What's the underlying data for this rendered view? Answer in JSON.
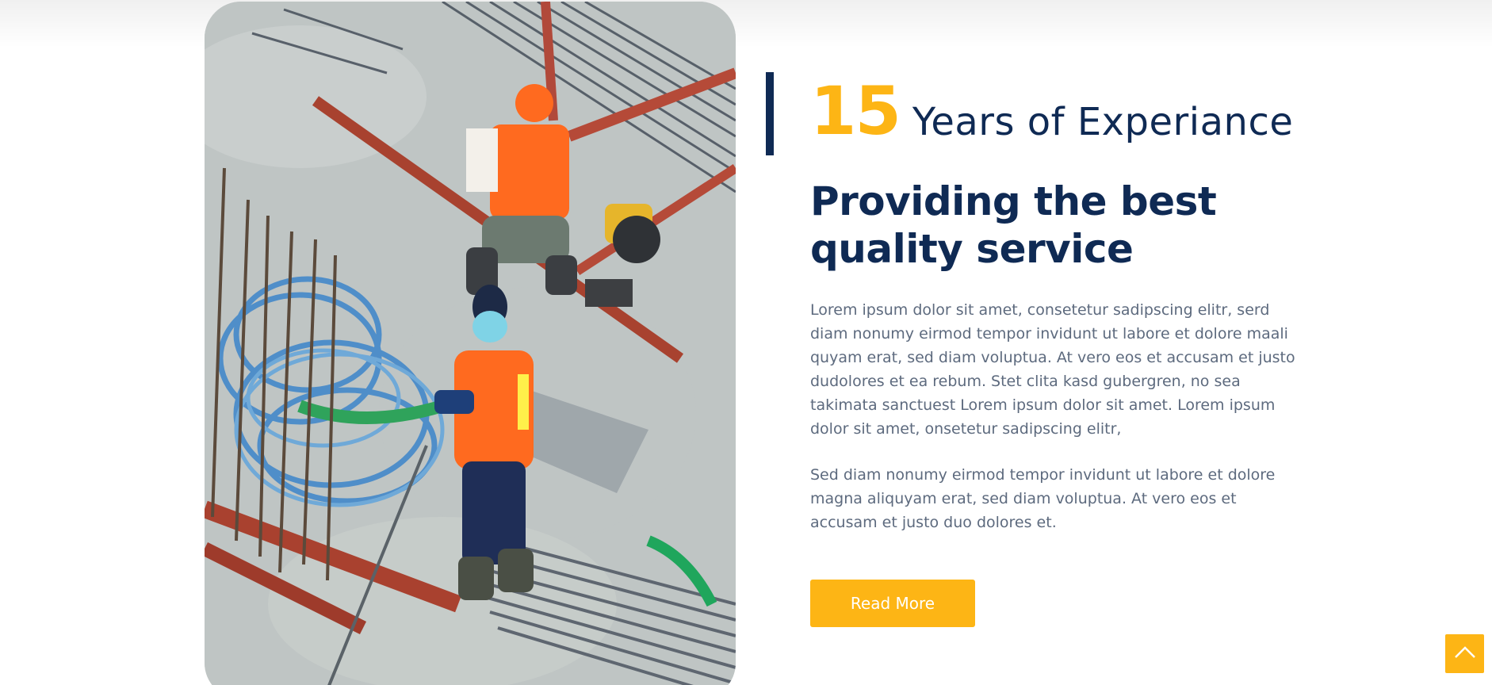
{
  "experience": {
    "number": "15",
    "label": "Years of Experiance"
  },
  "about": {
    "heading": "Providing the best quality service",
    "paragraph_1": "Lorem ipsum dolor sit amet, consetetur sadipscing elitr, serd diam nonumy eirmod tempor invidunt ut labore et dolore maali quyam erat, sed diam voluptua. At vero eos et accusam et justo dudolores et ea rebum. Stet clita kasd gubergren, no sea takimata sanctuest Lorem ipsum dolor sit amet. Lorem ipsum dolor sit amet, onsetetur sadipscing elitr,",
    "paragraph_2": "Sed diam nonumy eirmod tempor invidunt ut labore et dolore magna aliquyam erat, sed diam voluptua. At vero eos et accusam et justo duo dolores et.",
    "button_label": "Read More"
  },
  "icons": {
    "back_to_top": "chevron-up-icon"
  },
  "colors": {
    "accent": "#fdb515",
    "navy": "#0f2a54",
    "body_text": "#5d6a7e"
  }
}
